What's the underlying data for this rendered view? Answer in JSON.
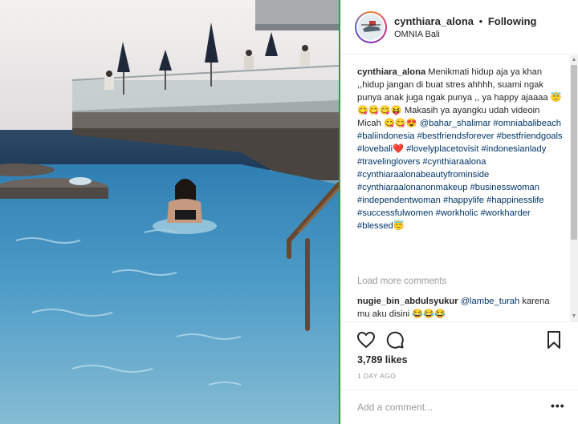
{
  "post": {
    "username": "cynthiara_alona",
    "separator": "•",
    "follow_status": "Following",
    "location": "OMNIA Bali"
  },
  "caption": {
    "username": "cynthiara_alona",
    "text_before_tags": "Menikmati hidup aja ya khan ,,hidup jangan di buat stres ahhhh, suami ngak punya anak juga ngak punya ,, ya happy ajaaaa 😇😋😋😋😝 Makasih ya ayangku udah videoin Micah 😋😋😍",
    "hashtags_line": "@bahar_shalimar #omniabalibeach #baliindonesia #bestfriendsforever #bestfriendgoals #lovebali❤️ #lovelyplacetovisit #indonesianlady #travelinglovers #cynthiaraalona #cynthiaraalonabeautyfrominside #cynthiaraalonanonmakeup #businesswoman #independentwoman #happylife #happinesslife #successfulwomen #workholic #workharder #blessed😇"
  },
  "load_more_label": "Load more comments",
  "comment": {
    "username": "nugie_bin_abdulsyukur",
    "mention": "@lambe_turah",
    "text": "karena mu aku disini 😂😂😂"
  },
  "stats": {
    "likes": "3,789 likes",
    "time": "1 DAY AGO"
  },
  "add_comment": {
    "placeholder": "Add a comment...",
    "more_label": "•••"
  },
  "colors": {
    "link": "#003569",
    "muted": "#999999",
    "divider_accent": "#2e9e4a"
  }
}
